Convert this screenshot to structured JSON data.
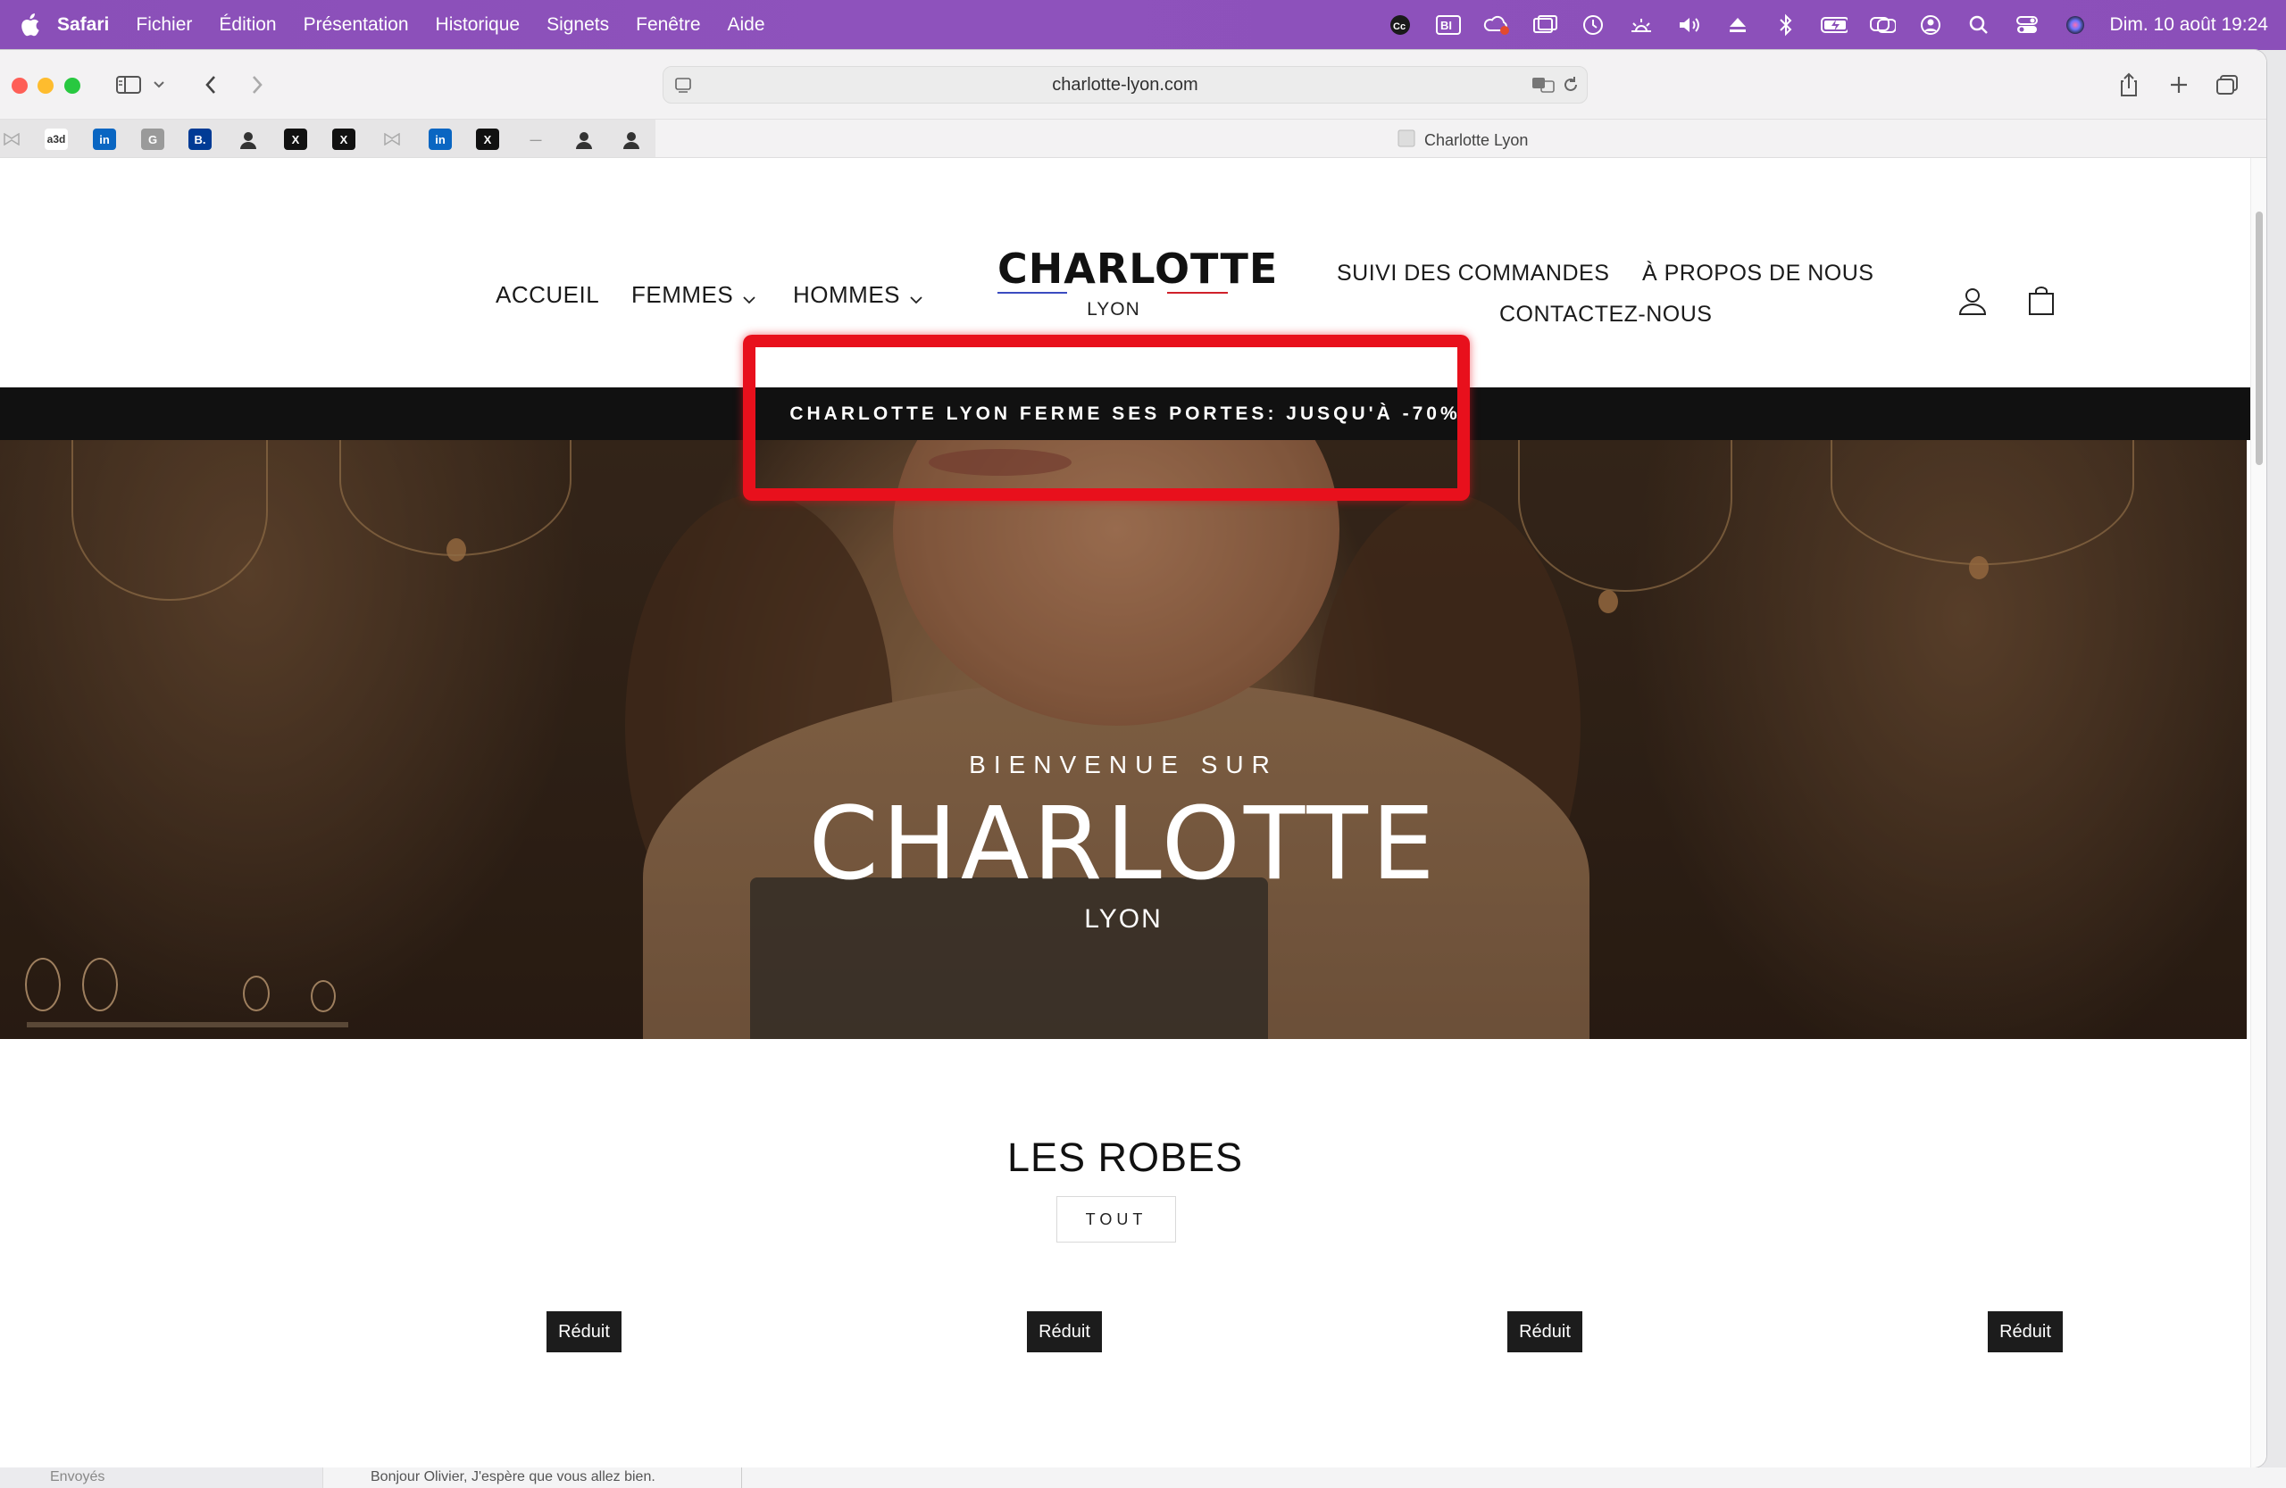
{
  "menubar": {
    "app": "Safari",
    "items": [
      "Fichier",
      "Édition",
      "Présentation",
      "Historique",
      "Signets",
      "Fenêtre",
      "Aide"
    ],
    "clock": "Dim. 10 août  19:24",
    "status_icons": [
      "cc-icon",
      "bi-icon",
      "creative-cloud-icon",
      "window-icon",
      "time-machine-icon",
      "brightness-icon",
      "volume-icon",
      "eject-icon",
      "bluetooth-icon",
      "battery-icon",
      "screen-mirroring-icon",
      "user-icon",
      "search-icon",
      "control-center-icon",
      "siri-icon"
    ]
  },
  "browser": {
    "url": "charlotte-lyon.com",
    "tab_title": "Charlotte Lyon",
    "bookmarks": [
      {
        "icon": "reading-icon",
        "text": ""
      },
      {
        "icon": "a3d-icon",
        "text": "a3d"
      },
      {
        "icon": "linkedin-icon",
        "text": "in"
      },
      {
        "icon": "g-icon",
        "text": "G"
      },
      {
        "icon": "booking-icon",
        "text": "B."
      },
      {
        "icon": "person-icon",
        "text": ""
      },
      {
        "icon": "x-icon",
        "text": "X"
      },
      {
        "icon": "x-icon",
        "text": "X"
      },
      {
        "icon": "reading-icon",
        "text": ""
      },
      {
        "icon": "linkedin-icon",
        "text": "in"
      },
      {
        "icon": "x-icon",
        "text": "X"
      },
      {
        "icon": "dash-icon",
        "text": "—"
      },
      {
        "icon": "person-icon",
        "text": ""
      },
      {
        "icon": "person-icon",
        "text": ""
      }
    ]
  },
  "site": {
    "nav_left": [
      "ACCUEIL",
      "FEMMES",
      "HOMMES"
    ],
    "logo_name": "CHARLOTTE",
    "logo_city": "LYON",
    "nav_right": [
      "SUIVI DES COMMANDES",
      "À PROPOS DE NOUS",
      "CONTACTEZ-NOUS"
    ],
    "announcement": "CHARLOTTE LYON FERME SES PORTES: JUSQU'À -70%",
    "hero": {
      "welcome": "BIENVENUE SUR",
      "title": "CHARLOTTE",
      "subtitle": "LYON"
    },
    "section_title": "LES ROBES",
    "all_button": "TOUT",
    "badges": [
      "Réduit",
      "Réduit",
      "Réduit",
      "Réduit"
    ]
  },
  "behind_window": {
    "sidebar_text": "Envoyés",
    "message_preview": "Bonjour Olivier, J'espère que vous allez bien."
  },
  "colors": {
    "menubar": "#8b4fb9",
    "announcement_bg": "#111111",
    "highlight": "#e8101c",
    "logo_underline_blue": "#3b4cc0",
    "logo_underline_red": "#d0202a"
  }
}
